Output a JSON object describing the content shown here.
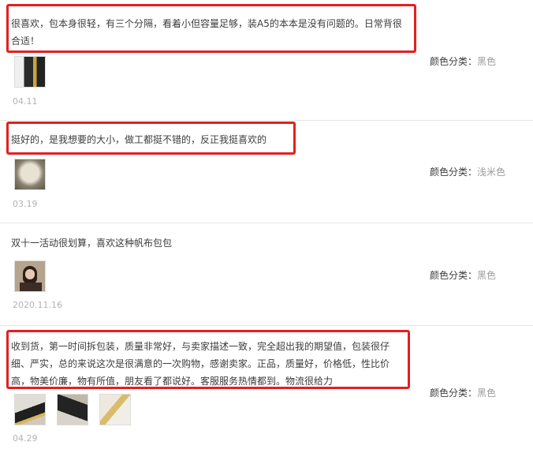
{
  "reviews": [
    {
      "text": "很喜欢，包本身很轻，有三个分隔，看着小但容量足够，装A5的本本是没有问题的。日常背很合适！",
      "date": "04.11",
      "sku_label": "颜色分类：",
      "sku_value": "黑色",
      "photo_count": 1,
      "highlighted": true
    },
    {
      "text": "挺好的，是我想要的大小，做工都挺不错的，反正我挺喜欢的",
      "date": "03.19",
      "sku_label": "颜色分类：",
      "sku_value": "浅米色",
      "photo_count": 1,
      "highlighted": true
    },
    {
      "text": "双十一活动很划算，喜欢这种帆布包包",
      "date": "2020.11.16",
      "sku_label": "颜色分类：",
      "sku_value": "黑色",
      "photo_count": 1,
      "highlighted": false
    },
    {
      "text": "收到货，第一时间拆包装，质量非常好，与卖家描述一致，完全超出我的期望值，包装很仔细、严实，总的来说这次是很满意的一次购物，感谢卖家。正品，质量好，价格低，性比价高，物美价廉，物有所值，朋友看了都说好。客服服务热情都到。物流很给力",
      "date": "04.29",
      "sku_label": "颜色分类：",
      "sku_value": "黑色",
      "photo_count": 3,
      "highlighted": true
    }
  ],
  "colors": {
    "highlight": "#e41f1f",
    "divider": "#e6e6e6",
    "date": "#b3b3b3",
    "sku_value": "#9c9c9c"
  }
}
